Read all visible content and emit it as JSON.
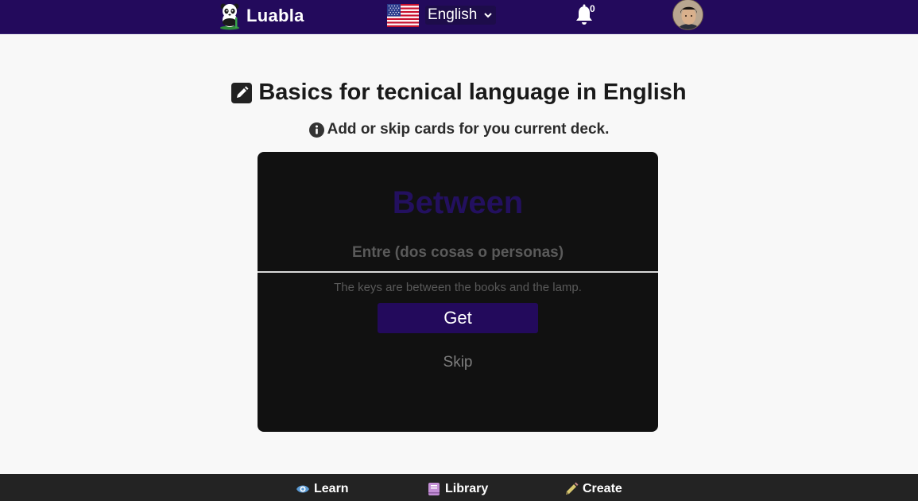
{
  "header": {
    "brand_name": "Luabla",
    "language": {
      "selected": "English"
    },
    "notifications": {
      "count": "0"
    }
  },
  "main": {
    "title": "Basics for tecnical language in English",
    "subtitle": "Add or skip cards for you current deck.",
    "card": {
      "word": "Between",
      "translation": "Entre (dos cosas o personas)",
      "example": "The keys are between the books and the lamp.",
      "get_label": "Get",
      "skip_label": "Skip"
    }
  },
  "bottom_nav": {
    "items": [
      {
        "label": "Learn",
        "icon": "eye-icon",
        "icon_color": "#5b9bd5"
      },
      {
        "label": "Library",
        "icon": "book-icon",
        "icon_color": "#c48fd6"
      },
      {
        "label": "Create",
        "icon": "pencil-icon",
        "icon_color": "#d8c870"
      }
    ]
  },
  "colors": {
    "header_bg": "#230a5c",
    "card_bg": "#111111",
    "accent": "#23105f",
    "footer_bg": "#232323"
  }
}
